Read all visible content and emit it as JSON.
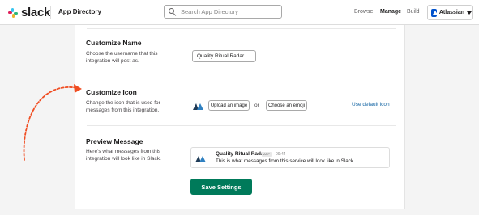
{
  "header": {
    "brand": "slack",
    "section": "App Directory",
    "search_placeholder": "Search App Directory",
    "nav": [
      "Browse",
      "Manage",
      "Build"
    ],
    "active_nav": "Manage",
    "workspace": "Atlassian"
  },
  "customize_name": {
    "title": "Customize Name",
    "description": "Choose the username that this integration will post as.",
    "value": "Quality Ritual Radar"
  },
  "customize_icon": {
    "title": "Customize Icon",
    "description": "Change the icon that is used for messages from this integration.",
    "upload_label": "Upload an image",
    "or_label": "or",
    "emoji_label": "Choose an emoji",
    "default_link": "Use default icon"
  },
  "preview": {
    "title": "Preview Message",
    "description": "Here's what messages from this integration will look like in Slack.",
    "name": "Quality Ritual Radar",
    "badge": "APP",
    "time": "09:44",
    "message": "This is what messages from this service will look like in Slack."
  },
  "save_label": "Save Settings",
  "colors": {
    "primary_button": "#007a5a",
    "link": "#1264a3",
    "annotation_arrow": "#f04e23",
    "icon_dark": "#1f3b57",
    "icon_light": "#2f80c1"
  }
}
